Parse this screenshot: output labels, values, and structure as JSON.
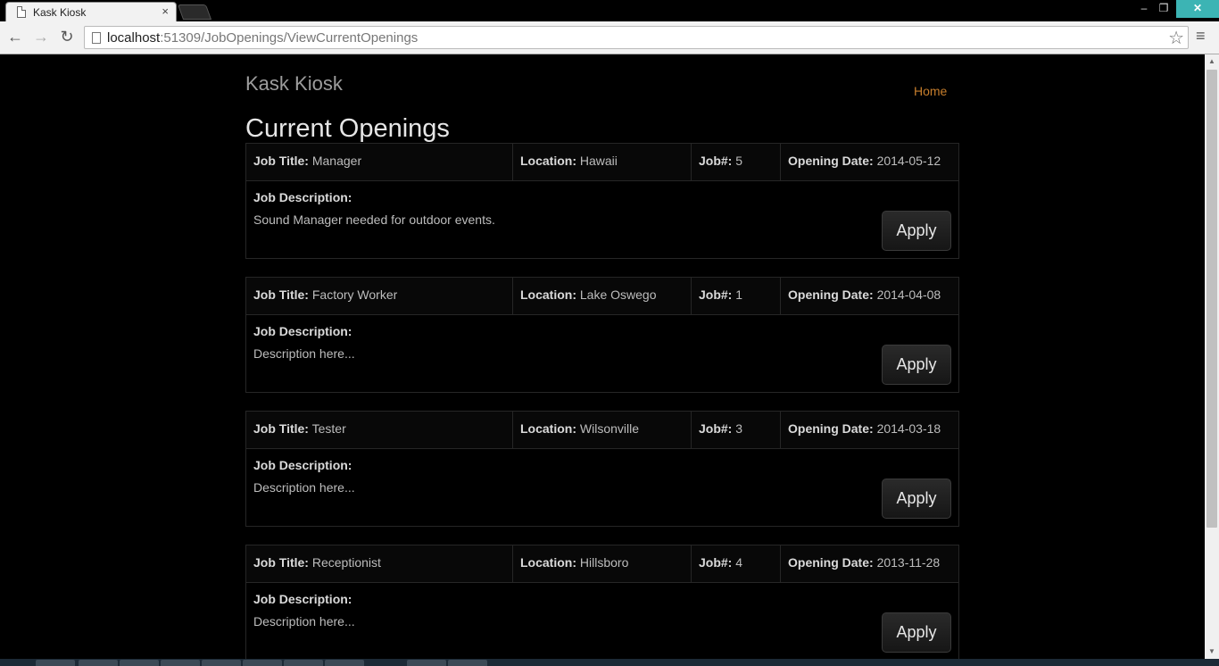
{
  "browser": {
    "tab_title": "Kask Kiosk",
    "tab_close": "×",
    "url_host": "localhost",
    "url_path": ":51309/JobOpenings/ViewCurrentOpenings",
    "icons": {
      "back": "←",
      "forward": "→",
      "reload": "↻",
      "star": "☆",
      "menu": "≡",
      "min": "–",
      "max": "❐",
      "close": "✕"
    }
  },
  "site": {
    "brand": "Kask Kiosk",
    "nav_home": "Home",
    "page_title": "Current Openings"
  },
  "labels": {
    "job_title": "Job Title:",
    "location": "Location:",
    "job_number": "Job#:",
    "opening_date": "Opening Date:",
    "job_description": "Job Description:",
    "apply": "Apply"
  },
  "jobs": [
    {
      "title": "Manager",
      "location": "Hawaii",
      "number": "5",
      "date": "2014-05-12",
      "description": "Sound Manager needed for outdoor events."
    },
    {
      "title": "Factory Worker",
      "location": "Lake Oswego",
      "number": "1",
      "date": "2014-04-08",
      "description": "Description here..."
    },
    {
      "title": "Tester",
      "location": "Wilsonville",
      "number": "3",
      "date": "2014-03-18",
      "description": "Description here..."
    },
    {
      "title": "Receptionist",
      "location": "Hillsboro",
      "number": "4",
      "date": "2013-11-28",
      "description": "Description here..."
    }
  ],
  "colors": {
    "page_bg": "#000000",
    "home_link": "#c77e2c",
    "window_close": "#3cb4b4"
  }
}
